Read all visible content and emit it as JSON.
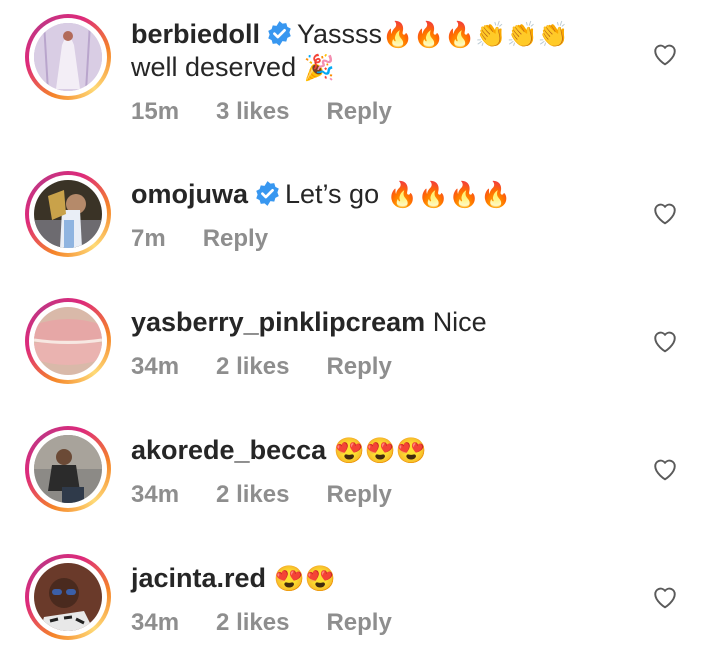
{
  "comments": [
    {
      "username": "berbiedoll",
      "verified": true,
      "text_line1": "Yassss",
      "emoji_line1": "🔥🔥🔥👏👏👏",
      "text_line2": "well deserved",
      "emoji_line2": "🎉",
      "time": "15m",
      "likes": "3 likes",
      "reply": "Reply"
    },
    {
      "username": "omojuwa",
      "verified": true,
      "text_line1": "Let’s go",
      "emoji_line1": "🔥🔥🔥🔥",
      "time": "7m",
      "likes": "",
      "reply": "Reply"
    },
    {
      "username": "yasberry_pinklipcream",
      "verified": false,
      "text_line1": "Nice",
      "emoji_line1": "",
      "time": "34m",
      "likes": "2 likes",
      "reply": "Reply"
    },
    {
      "username": "akorede_becca",
      "verified": false,
      "text_line1": "",
      "emoji_line1": "😍😍😍",
      "time": "34m",
      "likes": "2 likes",
      "reply": "Reply"
    },
    {
      "username": "jacinta.red",
      "verified": false,
      "text_line1": "",
      "emoji_line1": "😍😍",
      "time": "34m",
      "likes": "2 likes",
      "reply": "Reply"
    }
  ],
  "colors": {
    "verified_badge": "#3897f0",
    "meta_text": "#8e8e8e",
    "text": "#262626"
  },
  "icons": {
    "like": "heart-outline-icon",
    "verified": "verified-badge-icon"
  }
}
